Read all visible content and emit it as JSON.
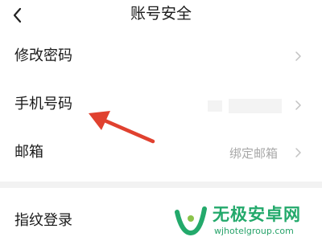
{
  "header": {
    "title": "账号安全",
    "back_icon": "chevron-left-icon"
  },
  "settings": {
    "change_password": {
      "label": "修改密码",
      "chevron": "chevron-right-icon"
    },
    "phone_number": {
      "label": "手机号码",
      "value_state": "blurred",
      "chevron": "chevron-right-icon"
    },
    "email": {
      "label": "邮箱",
      "value": "绑定邮箱",
      "chevron": "chevron-right-icon"
    },
    "fingerprint_login": {
      "label": "指纹登录"
    }
  },
  "annotation": {
    "type": "arrow",
    "color": "#e0412f",
    "points_to": "手机号码"
  },
  "watermark": {
    "title": "无极安卓网",
    "url": "wjhotelgroup.com",
    "accent": "#23a96b"
  }
}
